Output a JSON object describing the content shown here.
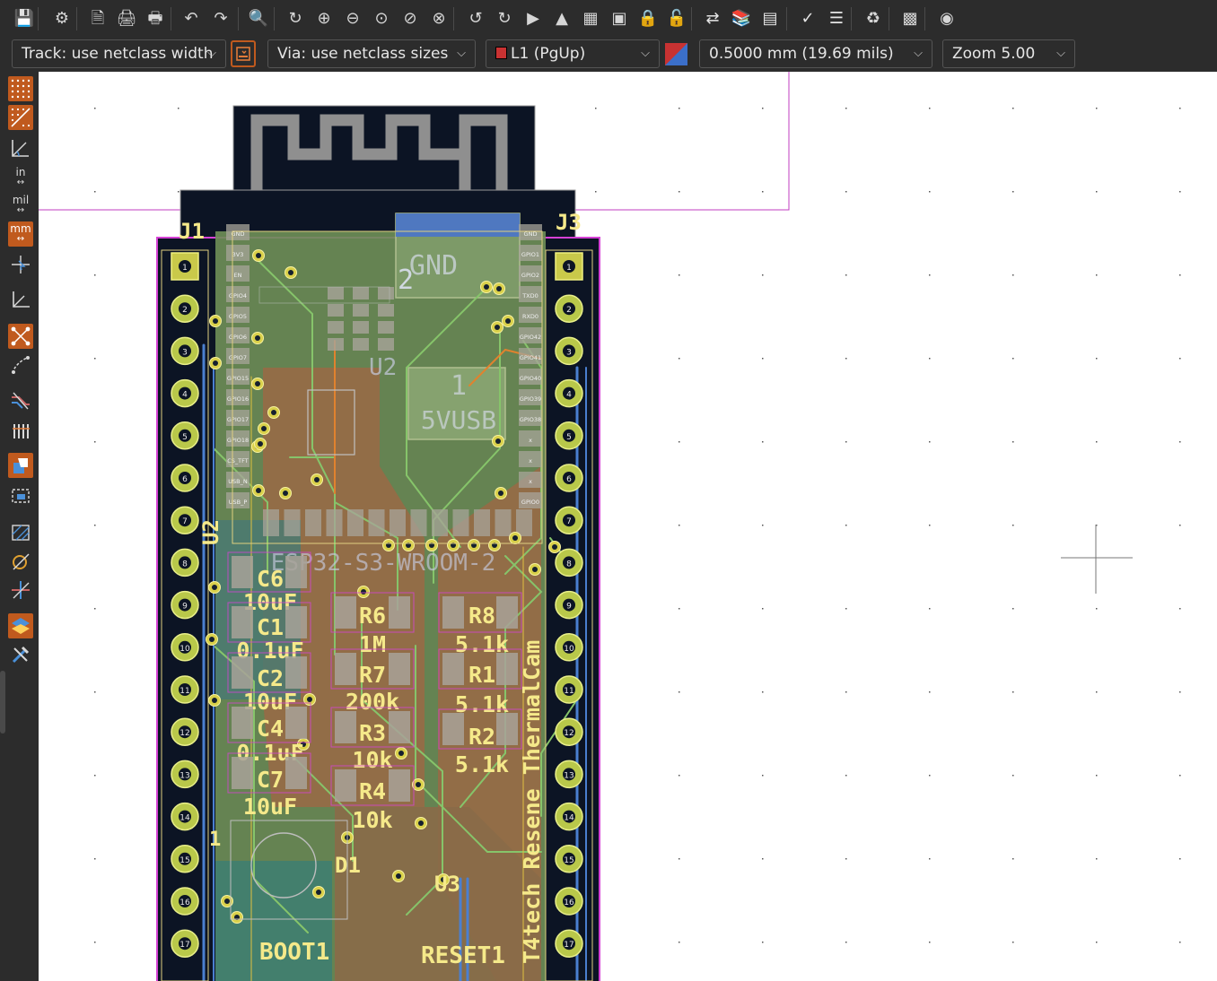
{
  "main_toolbar": {
    "buttons": [
      "save-icon",
      "board-setup-icon",
      "page-settings-icon",
      "print-icon",
      "plot-icon",
      "undo-icon",
      "redo-icon",
      "find-icon",
      "refresh-icon",
      "zoom-in-icon",
      "zoom-out-icon",
      "zoom-fit-icon",
      "zoom-objects-icon",
      "zoom-selection-icon",
      "rotate-ccw-icon",
      "rotate-cw-icon",
      "flip-icon",
      "mirror-icon",
      "group-icon",
      "ungroup-icon",
      "lock-icon",
      "unlock-icon",
      "netlist-update-icon",
      "footprint-browser-icon",
      "footprint-editor-icon",
      "drc-icon",
      "board-stats-icon",
      "router-icon",
      "scripting-console-icon",
      "plugin-icon"
    ]
  },
  "options_bar": {
    "track_width": "Track: use netclass width",
    "via_size": "Via: use netclass sizes",
    "layer": "L1 (PgUp)",
    "layer_color": "#c83232",
    "grid": "0.5000 mm (19.69 mils)",
    "zoom": "Zoom 5.00"
  },
  "left_toolbar": {
    "unit_in": "in",
    "unit_mil": "mil",
    "unit_mm": "mm"
  },
  "board": {
    "module": "U2",
    "module_value": "ESP32-S3-WROOM-2",
    "header_left": "J1",
    "header_right": "J3",
    "usb_pin_2": "2",
    "usb_pin_2_net": "GND",
    "usb_pin_1": "1",
    "usb_pin_1_net": "5VUSB",
    "silk_title": "T4tech Resene ThermalCam",
    "components": [
      {
        "ref": "C6",
        "value": "10uF"
      },
      {
        "ref": "C1",
        "value": "0.1uF"
      },
      {
        "ref": "C2",
        "value": "10uF"
      },
      {
        "ref": "C4",
        "value": "0.1uF"
      },
      {
        "ref": "C7",
        "value": "10uF"
      },
      {
        "ref": "R6",
        "value": "1M"
      },
      {
        "ref": "R7",
        "value": "200k"
      },
      {
        "ref": "R3",
        "value": "10k"
      },
      {
        "ref": "R4",
        "value": "10k"
      },
      {
        "ref": "R8",
        "value": "5.1k"
      },
      {
        "ref": "R1",
        "value": "5.1k"
      },
      {
        "ref": "R2",
        "value": "5.1k"
      }
    ],
    "d1": "D1",
    "d1_pin": "1",
    "u3": "U3",
    "boot": "BOOT1",
    "reset": "RESET1",
    "pad_labels_left": [
      "1",
      "2",
      "3",
      "4",
      "5",
      "6",
      "7",
      "8",
      "9",
      "10",
      "11",
      "12",
      "13",
      "14",
      "15",
      "16",
      "17"
    ],
    "pad_labels_right": [
      "1",
      "2",
      "3",
      "4",
      "5",
      "6",
      "7",
      "8",
      "9",
      "10",
      "11",
      "12",
      "13",
      "14",
      "15",
      "16",
      "17"
    ],
    "module_pins_left": [
      "GND",
      "3V3",
      "EN",
      "GPIO4",
      "GPIO5",
      "GPIO6",
      "GPIO7",
      "GPIO15",
      "GPIO16",
      "GPIO17",
      "GPIO18",
      "CS_TFT",
      "USB_N",
      "USB_P"
    ],
    "module_pins_right": [
      "GND",
      "GPIO1",
      "GPIO2",
      "TXD0",
      "RXD0",
      "GPIO42",
      "GPIO41",
      "GPIO40",
      "GPIO39",
      "GPIO38",
      "x",
      "x",
      "x",
      "GPIO0"
    ]
  }
}
